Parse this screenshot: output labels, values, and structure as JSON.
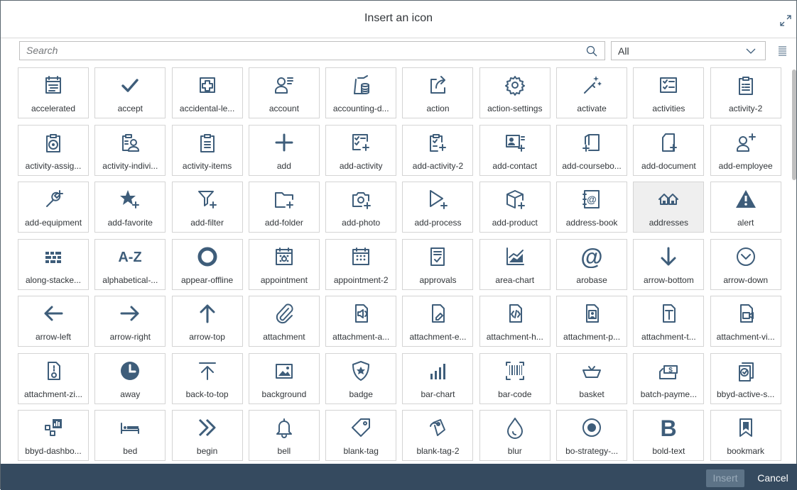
{
  "dialog": {
    "title": "Insert an icon",
    "expand_icon": "expand-icon"
  },
  "search": {
    "placeholder": "Search",
    "icon": "search-icon"
  },
  "filter": {
    "selected": "All",
    "icon": "chevron-down-icon"
  },
  "view_toggle": {
    "icon": "list-view-icon"
  },
  "colors": {
    "icon": "#3e5d7a",
    "footer": "#354a5f",
    "border": "#d4d4d4",
    "selected_tile": "#efefef"
  },
  "icons": [
    {
      "label": "accelerated",
      "icon": "calendar-accelerated-icon"
    },
    {
      "label": "accept",
      "icon": "checkmark-icon"
    },
    {
      "label": "accidental-le...",
      "icon": "medical-cross-icon"
    },
    {
      "label": "account",
      "icon": "person-list-icon"
    },
    {
      "label": "accounting-d...",
      "icon": "document-coins-icon"
    },
    {
      "label": "action",
      "icon": "share-arrow-icon"
    },
    {
      "label": "action-settings",
      "icon": "gear-icon"
    },
    {
      "label": "activate",
      "icon": "magic-wand-icon"
    },
    {
      "label": "activities",
      "icon": "checklist-icon"
    },
    {
      "label": "activity-2",
      "icon": "clipboard-list-icon"
    },
    {
      "label": "activity-assig...",
      "icon": "clipboard-target-icon"
    },
    {
      "label": "activity-indivi...",
      "icon": "clipboard-person-icon"
    },
    {
      "label": "activity-items",
      "icon": "clipboard-items-icon"
    },
    {
      "label": "add",
      "icon": "plus-icon"
    },
    {
      "label": "add-activity",
      "icon": "checklist-add-icon"
    },
    {
      "label": "add-activity-2",
      "icon": "clipboard-add-icon"
    },
    {
      "label": "add-contact",
      "icon": "contact-card-add-icon"
    },
    {
      "label": "add-coursebo...",
      "icon": "book-add-icon"
    },
    {
      "label": "add-document",
      "icon": "document-add-icon"
    },
    {
      "label": "add-employee",
      "icon": "person-add-icon"
    },
    {
      "label": "add-equipment",
      "icon": "wrench-add-icon"
    },
    {
      "label": "add-favorite",
      "icon": "star-add-icon"
    },
    {
      "label": "add-filter",
      "icon": "filter-add-icon"
    },
    {
      "label": "add-folder",
      "icon": "folder-add-icon"
    },
    {
      "label": "add-photo",
      "icon": "camera-add-icon"
    },
    {
      "label": "add-process",
      "icon": "play-add-icon"
    },
    {
      "label": "add-product",
      "icon": "product-add-icon"
    },
    {
      "label": "address-book",
      "icon": "address-book-icon"
    },
    {
      "label": "addresses",
      "icon": "houses-icon"
    },
    {
      "label": "alert",
      "icon": "warning-triangle-icon"
    },
    {
      "label": "along-stacke...",
      "icon": "stacked-bars-icon"
    },
    {
      "label": "alphabetical-...",
      "icon": "a-z-icon"
    },
    {
      "label": "appear-offline",
      "icon": "ring-icon"
    },
    {
      "label": "appointment",
      "icon": "calendar-dots-icon"
    },
    {
      "label": "appointment-2",
      "icon": "calendar-grid-icon"
    },
    {
      "label": "approvals",
      "icon": "document-check-icon"
    },
    {
      "label": "area-chart",
      "icon": "area-chart-icon"
    },
    {
      "label": "arobase",
      "icon": "at-sign-icon"
    },
    {
      "label": "arrow-bottom",
      "icon": "arrow-down-icon"
    },
    {
      "label": "arrow-down",
      "icon": "circle-chevron-down-icon"
    },
    {
      "label": "arrow-left",
      "icon": "arrow-left-icon"
    },
    {
      "label": "arrow-right",
      "icon": "arrow-right-icon"
    },
    {
      "label": "arrow-top",
      "icon": "arrow-up-icon"
    },
    {
      "label": "attachment",
      "icon": "paperclip-icon"
    },
    {
      "label": "attachment-a...",
      "icon": "attachment-audio-icon"
    },
    {
      "label": "attachment-e...",
      "icon": "attachment-edit-icon"
    },
    {
      "label": "attachment-h...",
      "icon": "attachment-html-icon"
    },
    {
      "label": "attachment-p...",
      "icon": "attachment-photo-icon"
    },
    {
      "label": "attachment-t...",
      "icon": "attachment-text-icon"
    },
    {
      "label": "attachment-vi...",
      "icon": "attachment-video-icon"
    },
    {
      "label": "attachment-zi...",
      "icon": "attachment-zip-icon"
    },
    {
      "label": "away",
      "icon": "clock-filled-icon"
    },
    {
      "label": "back-to-top",
      "icon": "back-to-top-icon"
    },
    {
      "label": "background",
      "icon": "image-icon"
    },
    {
      "label": "badge",
      "icon": "shield-star-icon"
    },
    {
      "label": "bar-chart",
      "icon": "bar-chart-icon"
    },
    {
      "label": "bar-code",
      "icon": "barcode-icon"
    },
    {
      "label": "basket",
      "icon": "basket-icon"
    },
    {
      "label": "batch-payme...",
      "icon": "money-stack-icon"
    },
    {
      "label": "bbyd-active-s...",
      "icon": "active-sales-icon"
    },
    {
      "label": "bbyd-dashbo...",
      "icon": "dashboard-icon"
    },
    {
      "label": "bed",
      "icon": "bed-icon"
    },
    {
      "label": "begin",
      "icon": "double-arrow-right-icon"
    },
    {
      "label": "bell",
      "icon": "bell-icon"
    },
    {
      "label": "blank-tag",
      "icon": "tag-icon"
    },
    {
      "label": "blank-tag-2",
      "icon": "tag-2-icon"
    },
    {
      "label": "blur",
      "icon": "droplet-icon"
    },
    {
      "label": "bo-strategy-...",
      "icon": "target-dot-icon"
    },
    {
      "label": "bold-text",
      "icon": "bold-b-icon"
    },
    {
      "label": "bookmark",
      "icon": "bookmark-icon"
    }
  ],
  "selected_icon_label": "addresses",
  "footer": {
    "insert_label": "Insert",
    "cancel_label": "Cancel"
  }
}
